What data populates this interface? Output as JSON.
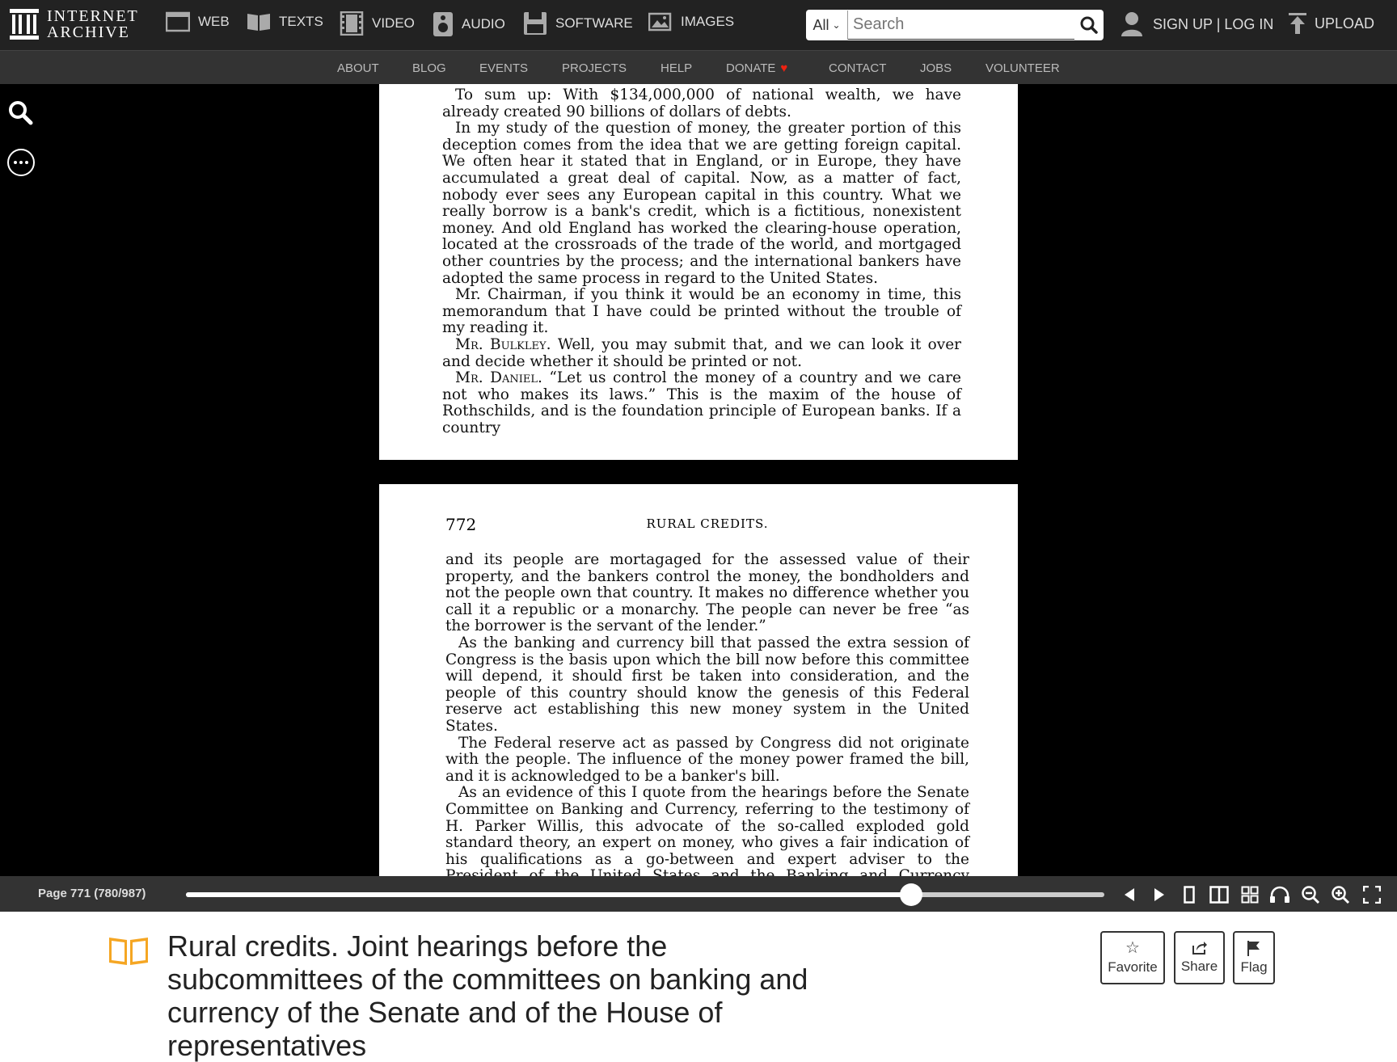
{
  "topnav": {
    "logo_line1": "INTERNET",
    "logo_line2": "ARCHIVE",
    "media": [
      {
        "label": "WEB",
        "icon": "web-icon"
      },
      {
        "label": "TEXTS",
        "icon": "book-icon"
      },
      {
        "label": "VIDEO",
        "icon": "film-icon"
      },
      {
        "label": "AUDIO",
        "icon": "speaker-icon"
      },
      {
        "label": "SOFTWARE",
        "icon": "floppy-icon"
      },
      {
        "label": "IMAGES",
        "icon": "image-icon"
      }
    ],
    "search_scope": "All",
    "search_placeholder": "Search",
    "signup": "SIGN UP",
    "separator": "|",
    "login": "LOG IN",
    "upload": "UPLOAD"
  },
  "subnav": [
    "ABOUT",
    "BLOG",
    "EVENTS",
    "PROJECTS",
    "HELP",
    "DONATE",
    "CONTACT",
    "JOBS",
    "VOLUNTEER"
  ],
  "page_top": {
    "paragraphs": [
      "To sum up: With $134,000,000 of national wealth, we have already created 90 billions of dollars of debts.",
      "In my study of the question of money, the greater portion of this deception comes from the idea that we are getting foreign capital. We often hear it stated that in England, or in Europe, they have accumulated a great deal of capital. Now, as a matter of fact, nobody ever sees any European capital in this country. What we really borrow is a bank's credit, which is a fictitious, nonexistent money. And old England has worked the clearing-house operation, located at the crossroads of the trade of the world, and mortgaged other countries by the process; and the international bankers have adopted the same process in regard to the United States.",
      "Mr. Chairman, if you think it would be an economy in time, this memorandum that I have could be printed without the trouble of my reading it."
    ],
    "bulkley_speaker": "Mr. Bulkley.",
    "bulkley_text": " Well, you may submit that, and we can look it over and decide whether it should be printed or not.",
    "daniel_speaker": "Mr. Daniel.",
    "daniel_text": " “Let us control the money of a country and we care not who makes its laws.” This is the maxim of the house of Rothschilds, and is the foundation principle of European banks. If a country"
  },
  "page_bottom": {
    "page_number": "772",
    "running_head": "RURAL CREDITS.",
    "first_paragraph": "and its people are mortagaged for the assessed value of their property, and the bankers control the money, the bondholders and not the people own that country. It makes no difference whether you call it a republic or a monarchy. The people can never be free “as the borrower is the servant of the lender.”",
    "paragraphs": [
      "As the banking and currency bill that passed the extra session of Congress is the basis upon which the bill now before this committee will depend, it should first be taken into consideration, and the people of this country should know the genesis of this Federal reserve act establishing this new money system in the United States.",
      "The Federal reserve act as passed by Congress did not originate with the people. The influence of the money power framed the bill, and it is acknowledged to be a banker's bill.",
      "As an evidence of this I quote from the hearings before the Senate Committee on Banking and Currency, referring to the testimony of H. Parker Willis, this advocate of the so-called exploded gold standard theory, an expert on money, who gives a fair indication of his qualifications as a go-between and expert adviser to the President of the United States and the Banking and Currency Committee of Congress, in the following statement of his economic calculation:"
    ]
  },
  "controls": {
    "page_label": "Page 771 (780/987)",
    "progress_fraction": 0.79
  },
  "item": {
    "title": "Rural credits. Joint hearings before the subcommittees of the committees on banking and currency of the Senate and of the House of representatives",
    "favorite": "Favorite",
    "share": "Share",
    "flag": "Flag"
  },
  "colors": {
    "topbar": "#222222",
    "subbar": "#333333",
    "book_icon": "#f5a623",
    "heart": "#ee2211"
  }
}
